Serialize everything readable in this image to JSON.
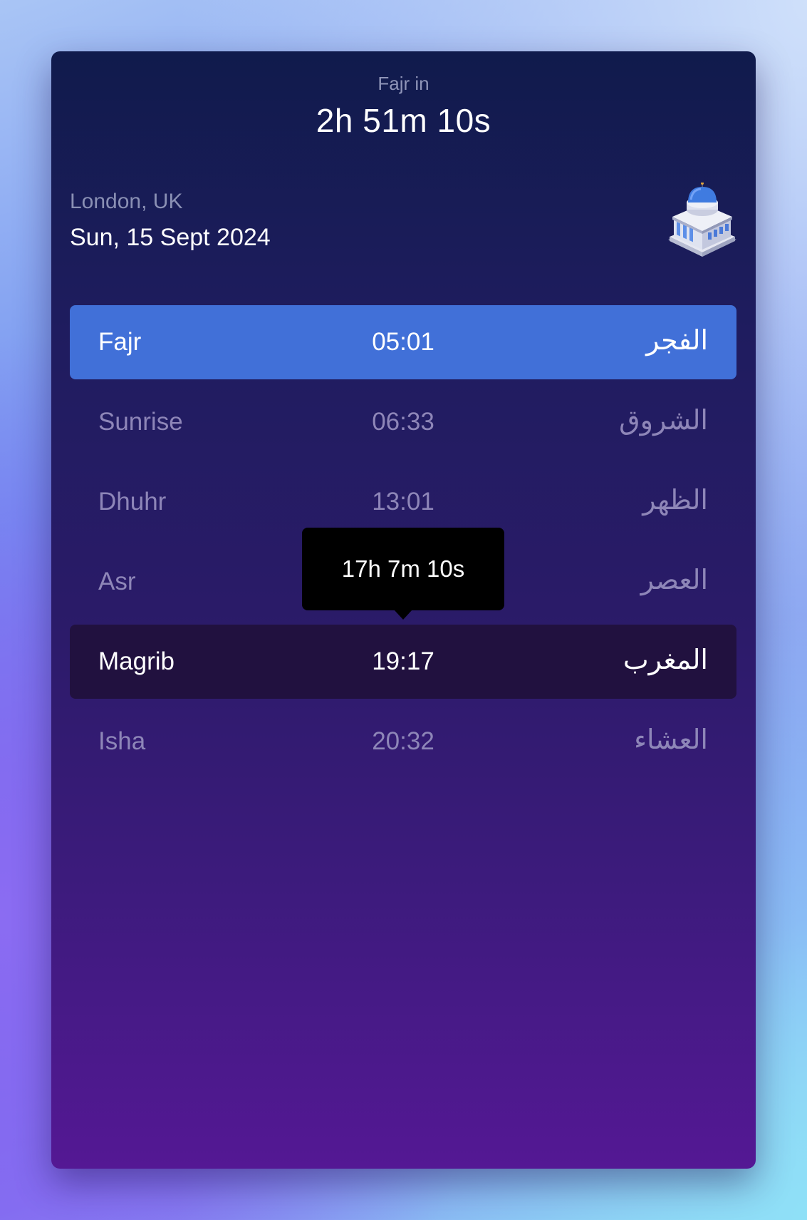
{
  "header": {
    "countdown_label": "Fajr in",
    "countdown_value": "2h 51m 10s"
  },
  "location": {
    "city": "London, UK",
    "date": "Sun, 15 Sept 2024"
  },
  "icon": "mosque-icon",
  "prayers": [
    {
      "name": "Fajr",
      "time": "05:01",
      "arabic": "الفجر",
      "state": "next"
    },
    {
      "name": "Sunrise",
      "time": "06:33",
      "arabic": "الشروق",
      "state": "normal"
    },
    {
      "name": "Dhuhr",
      "time": "13:01",
      "arabic": "الظهر",
      "state": "normal"
    },
    {
      "name": "Asr",
      "time": "",
      "arabic": "العصر",
      "state": "normal"
    },
    {
      "name": "Magrib",
      "time": "19:17",
      "arabic": "المغرب",
      "state": "current"
    },
    {
      "name": "Isha",
      "time": "20:32",
      "arabic": "العشاء",
      "state": "normal"
    }
  ],
  "tooltip": {
    "text": "17h 7m 10s"
  },
  "colors": {
    "next_row": "#4170d8",
    "current_row": "#21113f",
    "card_top": "#101b4c",
    "card_bottom": "#541894"
  }
}
